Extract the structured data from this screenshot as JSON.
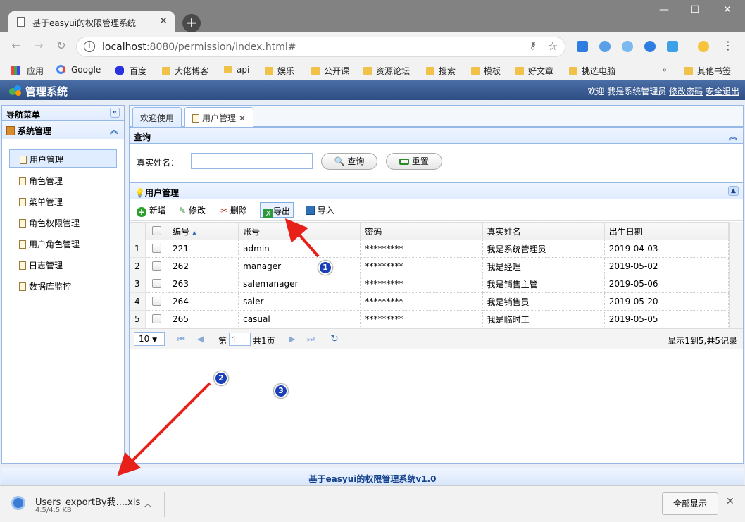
{
  "browser": {
    "tab_title": "基于easyui的权限管理系统",
    "url_host": "localhost",
    "url_rest": ":8080/permission/index.html#",
    "bookmarks": [
      "应用",
      "Google",
      "百度",
      "大佬博客",
      "api",
      "娱乐",
      "公开课",
      "资源论坛",
      "搜索",
      "模板",
      "好文章",
      "挑选电脑"
    ],
    "other_bookmarks": "其他书签",
    "more": "»"
  },
  "app": {
    "title": "管理系统",
    "welcome": "欢迎 我是系统管理员",
    "change_password": "修改密码",
    "logout": "安全退出",
    "footer": "基于easyui的权限管理系统v1.0"
  },
  "nav": {
    "header": "导航菜单",
    "group": "系统管理",
    "items": [
      "用户管理",
      "角色管理",
      "菜单管理",
      "角色权限管理",
      "用户角色管理",
      "日志管理",
      "数据库监控"
    ]
  },
  "tabs": [
    "欢迎使用",
    "用户管理"
  ],
  "query": {
    "header": "查询",
    "label": "真实姓名：",
    "input_value": "",
    "search_label": "查询",
    "reset_label": "重置"
  },
  "grid": {
    "title": "用户管理",
    "toolbar": {
      "add": "新增",
      "edit": "修改",
      "delete": "删除",
      "export": "导出",
      "import": "导入"
    },
    "columns": [
      "编号",
      "账号",
      "密码",
      "真实姓名",
      "出生日期"
    ],
    "rows": [
      {
        "n": "1",
        "id": "221",
        "account": "admin",
        "pwd": "*********",
        "name": "我是系统管理员",
        "birth": "2019-04-03"
      },
      {
        "n": "2",
        "id": "262",
        "account": "manager",
        "pwd": "*********",
        "name": "我是经理",
        "birth": "2019-05-02"
      },
      {
        "n": "3",
        "id": "263",
        "account": "salemanager",
        "pwd": "*********",
        "name": "我是销售主管",
        "birth": "2019-05-06"
      },
      {
        "n": "4",
        "id": "264",
        "account": "saler",
        "pwd": "*********",
        "name": "我是销售员",
        "birth": "2019-05-20"
      },
      {
        "n": "5",
        "id": "265",
        "account": "casual",
        "pwd": "*********",
        "name": "我是临时工",
        "birth": "2019-05-05"
      }
    ],
    "pager": {
      "page_size": "10",
      "page_prefix": "第",
      "page_value": "1",
      "page_total": "共1页",
      "summary": "显示1到5,共5记录"
    }
  },
  "download": {
    "filename": "Users_exportBy我....xls",
    "size": "4.5/4.5 KB",
    "show_all": "全部显示"
  },
  "annotations": [
    "1",
    "2",
    "3"
  ],
  "colors": {
    "header_blue": "#2d4d82",
    "panel_border": "#95b8e7",
    "arrow_red": "#e8201a",
    "badge_blue": "#1a3fb8"
  }
}
